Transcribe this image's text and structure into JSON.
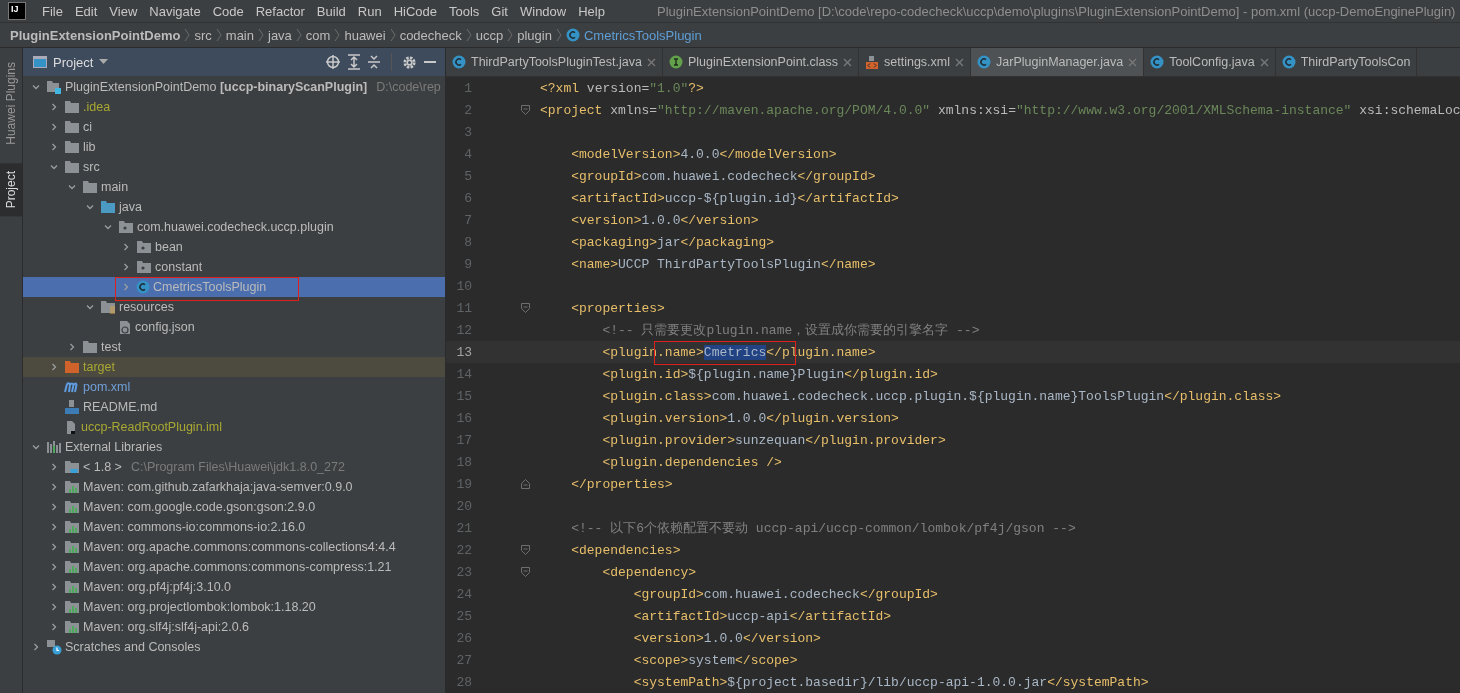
{
  "window": {
    "logo_text": "IJ",
    "title": "PluginExtensionPointDemo [D:\\code\\repo-codecheck\\uccp\\demo\\plugins\\PluginExtensionPointDemo] - pom.xml (uccp-DemoEnginePlugin)"
  },
  "menu": [
    "File",
    "Edit",
    "View",
    "Navigate",
    "Code",
    "Refactor",
    "Build",
    "Run",
    "HiCode",
    "Tools",
    "Git",
    "Window",
    "Help"
  ],
  "breadcrumbs": [
    {
      "label": "PluginExtensionPointDemo",
      "kind": "project"
    },
    {
      "label": "src",
      "kind": "folder"
    },
    {
      "label": "main",
      "kind": "folder"
    },
    {
      "label": "java",
      "kind": "folder"
    },
    {
      "label": "com",
      "kind": "folder"
    },
    {
      "label": "huawei",
      "kind": "folder"
    },
    {
      "label": "codecheck",
      "kind": "folder"
    },
    {
      "label": "uccp",
      "kind": "folder"
    },
    {
      "label": "plugin",
      "kind": "folder"
    },
    {
      "label": "CmetricsToolsPlugin",
      "kind": "class"
    }
  ],
  "side_tabs": [
    {
      "label": "Huawei Plugins",
      "selected": false
    },
    {
      "label": "Project",
      "selected": true
    }
  ],
  "project_panel": {
    "title": "Project",
    "tree": [
      {
        "label": "PluginExtensionPointDemo **[uccp-binaryScanPlugin]**",
        "path": "D:\\code\\rep",
        "kind": "module",
        "expanded": true,
        "selected": false,
        "color": "#bbbbbb",
        "children": [
          {
            "label": ".idea",
            "kind": "folder",
            "expanded": false,
            "selected": false,
            "color": "#a8a832"
          },
          {
            "label": "ci",
            "kind": "folder",
            "expanded": false,
            "selected": false,
            "color": "#bbbbbb"
          },
          {
            "label": "lib",
            "kind": "folder",
            "expanded": false,
            "selected": false,
            "color": "#bbbbbb"
          },
          {
            "label": "src",
            "kind": "folder",
            "expanded": true,
            "selected": false,
            "color": "#bbbbbb",
            "children": [
              {
                "label": "main",
                "kind": "folder",
                "expanded": true,
                "selected": false,
                "color": "#bbbbbb",
                "children": [
                  {
                    "label": "java",
                    "kind": "source-folder",
                    "expanded": true,
                    "selected": false,
                    "color": "#bbbbbb",
                    "children": [
                      {
                        "label": "com.huawei.codecheck.uccp.plugin",
                        "kind": "package",
                        "expanded": true,
                        "selected": false,
                        "color": "#bbbbbb",
                        "children": [
                          {
                            "label": "bean",
                            "kind": "package",
                            "expanded": false,
                            "selected": false,
                            "color": "#bbbbbb"
                          },
                          {
                            "label": "constant",
                            "kind": "package",
                            "expanded": false,
                            "selected": false,
                            "color": "#bbbbbb"
                          },
                          {
                            "label": "CmetricsToolsPlugin",
                            "kind": "class",
                            "expanded": false,
                            "selected": true,
                            "color": "#bbbbbb"
                          }
                        ]
                      }
                    ]
                  },
                  {
                    "label": "resources",
                    "kind": "resources-folder",
                    "expanded": true,
                    "selected": false,
                    "color": "#bbbbbb",
                    "children": [
                      {
                        "label": "config.json",
                        "kind": "json-file",
                        "selected": false,
                        "color": "#bbbbbb"
                      }
                    ]
                  }
                ]
              },
              {
                "label": "test",
                "kind": "folder",
                "expanded": false,
                "selected": false,
                "color": "#bbbbbb"
              }
            ]
          },
          {
            "label": "target",
            "kind": "excluded-folder",
            "expanded": false,
            "selected": false,
            "color": "#a8a832"
          },
          {
            "label": "pom.xml",
            "kind": "maven-file",
            "selected": false,
            "color": "#6f9fd8"
          },
          {
            "label": "README.md",
            "kind": "markdown-file",
            "selected": false,
            "color": "#bbbbbb"
          },
          {
            "label": "uccp-ReadRootPlugin.iml",
            "kind": "iml-file",
            "selected": false,
            "color": "#a8a832"
          }
        ]
      },
      {
        "label": "External Libraries",
        "kind": "libraries",
        "expanded": true,
        "selected": false,
        "color": "#bbbbbb",
        "children": [
          {
            "label": "< 1.8 >",
            "path": "C:\\Program Files\\Huawei\\jdk1.8.0_272",
            "kind": "jdk",
            "expanded": false,
            "selected": false,
            "color": "#bbbbbb"
          },
          {
            "label": "Maven: com.github.zafarkhaja:java-semver:0.9.0",
            "kind": "library",
            "expanded": false,
            "selected": false,
            "color": "#bbbbbb"
          },
          {
            "label": "Maven: com.google.code.gson:gson:2.9.0",
            "kind": "library",
            "expanded": false,
            "selected": false,
            "color": "#bbbbbb"
          },
          {
            "label": "Maven: commons-io:commons-io:2.16.0",
            "kind": "library",
            "expanded": false,
            "selected": false,
            "color": "#bbbbbb"
          },
          {
            "label": "Maven: org.apache.commons:commons-collections4:4.4",
            "kind": "library",
            "expanded": false,
            "selected": false,
            "color": "#bbbbbb"
          },
          {
            "label": "Maven: org.apache.commons:commons-compress:1.21",
            "kind": "library",
            "expanded": false,
            "selected": false,
            "color": "#bbbbbb"
          },
          {
            "label": "Maven: org.pf4j:pf4j:3.10.0",
            "kind": "library",
            "expanded": false,
            "selected": false,
            "color": "#bbbbbb"
          },
          {
            "label": "Maven: org.projectlombok:lombok:1.18.20",
            "kind": "library",
            "expanded": false,
            "selected": false,
            "color": "#bbbbbb"
          },
          {
            "label": "Maven: org.slf4j:slf4j-api:2.0.6",
            "kind": "library",
            "expanded": false,
            "selected": false,
            "color": "#bbbbbb"
          }
        ]
      },
      {
        "label": "Scratches and Consoles",
        "kind": "scratches",
        "expanded": false,
        "selected": false,
        "color": "#bbbbbb"
      }
    ]
  },
  "editor": {
    "tabs": [
      {
        "label": "ThirdPartyToolsPluginTest.java",
        "kind": "java-class",
        "selected": false,
        "close_button": true
      },
      {
        "label": "PluginExtensionPoint.class",
        "kind": "interface",
        "selected": false,
        "close_button": true
      },
      {
        "label": "settings.xml",
        "kind": "xml-file",
        "selected": false,
        "close_button": true
      },
      {
        "label": "JarPluginManager.java",
        "kind": "java-class",
        "selected": true,
        "close_button": true
      },
      {
        "label": "ToolConfig.java",
        "kind": "java-class",
        "selected": false,
        "close_button": true
      },
      {
        "label": "ThirdPartyToolsCon",
        "kind": "java-class",
        "selected": false,
        "close_button": false
      }
    ],
    "lines": [
      {
        "number": "1",
        "text": "<?xml version=\"1.0\"?>",
        "kind": "plain"
      },
      {
        "number": "2",
        "text": "<project xmlns=\"http://maven.apache.org/POM/4.0.0\" xmlns:xsi=\"http://www.w3.org/2001/XMLSchema-instance\" xsi:schemaLoc",
        "kind": "fold-start"
      },
      {
        "number": "3",
        "kind": "plain"
      },
      {
        "number": "4",
        "text": "    <modelVersion>4.0.0</modelVersion>"
      },
      {
        "number": "5",
        "text": "    <groupId>com.huawei.codecheck</groupId>"
      },
      {
        "number": "6",
        "text": "    <artifactId>uccp-${plugin.id}</artifactId>"
      },
      {
        "number": "7",
        "text": "    <version>1.0.0</version>"
      },
      {
        "number": "8",
        "text": "    <packaging>jar</packaging>"
      },
      {
        "number": "9",
        "text": "    <name>UCCP ThirdPartyToolsPlugin</name>"
      },
      {
        "number": "10",
        "kind": "plain"
      },
      {
        "number": "11",
        "text": "    <properties>",
        "kind": "fold-start"
      },
      {
        "number": "12",
        "text": "        <!-- 只需要更改plugin.name，设置成你需要的引擎名字 -->"
      },
      {
        "number": "13",
        "text": "        <plugin.name>",
        "selected_text": "Cmetrics",
        "text_after": "</plugin.name>",
        "current": true
      },
      {
        "number": "14",
        "text": "        <plugin.id>${plugin.name}Plugin</plugin.id>"
      },
      {
        "number": "15",
        "text": "        <plugin.class>com.huawei.codecheck.uccp.plugin.${plugin.name}ToolsPlugin</plugin.class>"
      },
      {
        "number": "16",
        "text": "        <plugin.version>1.0.0</plugin.version>"
      },
      {
        "number": "17",
        "text": "        <plugin.provider>sunzequan</plugin.provider>"
      },
      {
        "number": "18",
        "text": "        <plugin.dependencies />"
      },
      {
        "number": "19",
        "text": "    </properties>",
        "kind": "fold-end"
      },
      {
        "number": "20",
        "kind": "plain"
      },
      {
        "number": "21",
        "text": "    <!-- 以下6个依赖配置不要动 uccp-api/uccp-common/lombok/pf4j/gson -->"
      },
      {
        "number": "22",
        "text": "    <dependencies>",
        "kind": "fold-start"
      },
      {
        "number": "23",
        "text": "        <dependency>",
        "kind": "fold-start"
      },
      {
        "number": "24",
        "text": "            <groupId>com.huawei.codecheck</groupId>"
      },
      {
        "number": "25",
        "text": "            <artifactId>uccp-api</artifactId>"
      },
      {
        "number": "26",
        "text": "            <version>1.0.0</version>"
      },
      {
        "number": "27",
        "text": "            <scope>system</scope>"
      },
      {
        "number": "28",
        "text": "            <systemPath>${project.basedir}/lib/uccp-api-1.0.0.jar</systemPath>"
      }
    ]
  }
}
